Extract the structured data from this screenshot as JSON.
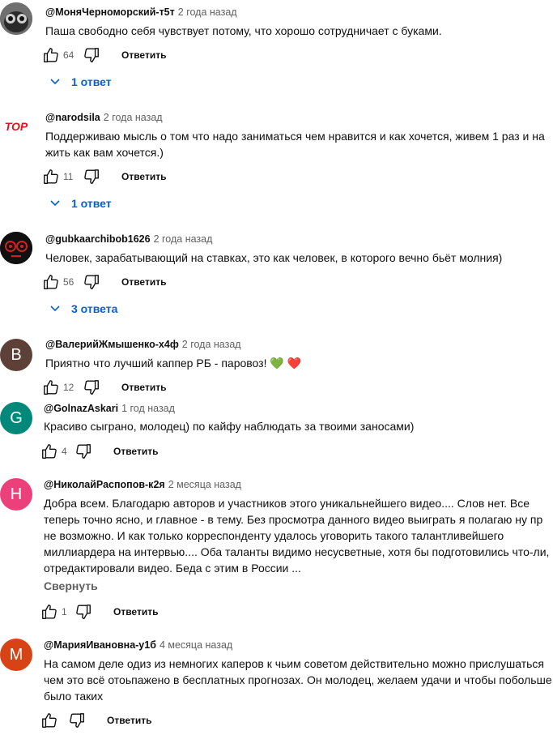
{
  "comments": [
    {
      "author": "@МоняЧерноморский-т5т",
      "time": "2 года назад",
      "lines": [
        "Паша свободно себя чувствует потому, что хорошо сотрудничает с буками."
      ],
      "likes": "64",
      "reply_label": "Ответить",
      "replies_label": "1 ответ",
      "avatar": {
        "type": "image",
        "color": "#4a4a4a"
      }
    },
    {
      "author": "@narodsila",
      "time": "2 года назад",
      "lines": [
        "Поддерживаю мысль о том что надо заниматься чем нравится и как хочется, живем 1 раз и на",
        "жить как вам хочется.)"
      ],
      "likes": "11",
      "reply_label": "Ответить",
      "replies_label": "1 ответ",
      "avatar": {
        "type": "logo",
        "text": "TOP",
        "color": "#e0141b"
      }
    },
    {
      "author": "@gubkaarchibob1626",
      "time": "2 года назад",
      "lines": [
        "Человек, зарабатывающий на ставках, это как человек, в которого вечно бьёт молния)"
      ],
      "likes": "56",
      "reply_label": "Ответить",
      "replies_label": "3 ответа",
      "avatar": {
        "type": "image",
        "color": "#111111"
      }
    },
    {
      "author": "@ВалерийЖмышенко-х4ф",
      "time": "2 года назад",
      "lines": [
        "Приятно что лучший каппер РБ - паровоз! 💚 ❤️"
      ],
      "likes": "12",
      "reply_label": "Ответить",
      "avatar": {
        "type": "letter",
        "letter": "B",
        "color": "#5d4037"
      }
    },
    {
      "author": "@GolnazAskari",
      "time": "1 год назад",
      "lines": [
        "Красиво сыграно, молодец) по кайфу наблюдать за твоими заносами)"
      ],
      "likes": "4",
      "reply_label": "Ответить",
      "avatar": {
        "type": "letter",
        "letter": "G",
        "color": "#00897b"
      }
    },
    {
      "author": "@НиколайРаспопов-к2я",
      "time": "2 месяца назад",
      "lines": [
        "Добра всем.  Благодарю авторов и участников  этого уникальнейшего видео.... Слов нет. Все",
        "теперь точно  ясно, и главное - в тему. Без просмотра данного видео выиграть я полагаю ну пр",
        "не возможно. И как только  корреспонденту удалось  уговорить такого талантливейшего",
        "миллиардера на интервью.... Оба таланты видимо несусветные, хотя бы подготовились что-ли,",
        "отредактировали видео. Беда с этим в России ..."
      ],
      "collapse_label": "Свернуть",
      "likes": "1",
      "reply_label": "Ответить",
      "avatar": {
        "type": "letter",
        "letter": "Н",
        "color": "#ec407a"
      }
    },
    {
      "author": "@МарияИвановна-у1б",
      "time": "4 месяца назад",
      "lines": [
        "На самом деле одиз из немногих каперов к чьим советом действительно можно прислушаться",
        "чем это всё отоьпажено в бесплатных прогнозах. Он молодец, желаем удачи и чтобы побольше",
        "было таких"
      ],
      "likes": "",
      "reply_label": "Ответить",
      "avatar": {
        "type": "letter",
        "letter": "M",
        "color": "#d84315"
      }
    }
  ],
  "colors": {
    "link": "#065fd4",
    "secondary": "#606060",
    "text": "#0f0f0f"
  }
}
